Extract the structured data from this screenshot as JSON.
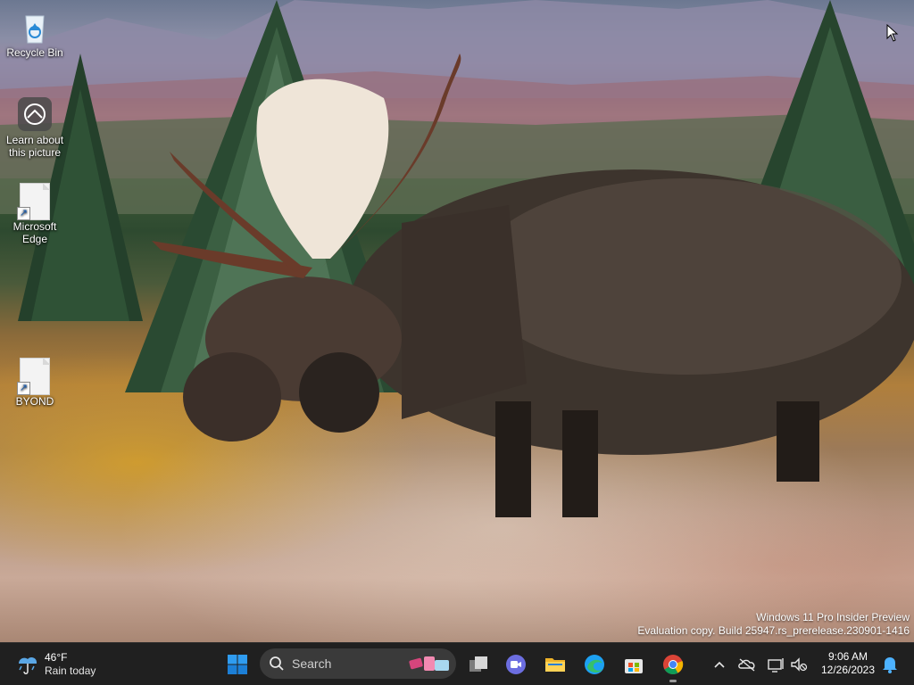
{
  "desktop": {
    "icons": [
      {
        "label": "Recycle Bin",
        "icon": "recycle-bin-icon"
      },
      {
        "label": "Learn about this picture",
        "icon": "learn-about-picture-icon"
      },
      {
        "label": "Microsoft Edge",
        "icon": "file-shortcut-icon"
      },
      {
        "label": "BYOND",
        "icon": "file-shortcut-icon"
      }
    ],
    "watermark": {
      "line1": "Windows 11 Pro Insider Preview",
      "line2": "Evaluation copy. Build 25947.rs_prerelease.230901-1416"
    }
  },
  "taskbar": {
    "weather": {
      "temp": "46°F",
      "text": "Rain today",
      "icon": "rain-cloud-icon"
    },
    "start_icon": "windows-start-icon",
    "search": {
      "placeholder": "Search",
      "icon": "search-icon"
    },
    "pinned": [
      {
        "name": "task-view",
        "icon": "task-view-icon"
      },
      {
        "name": "meet-now",
        "icon": "video-camera-icon"
      },
      {
        "name": "file-explorer",
        "icon": "folder-icon"
      },
      {
        "name": "microsoft-edge",
        "icon": "edge-icon"
      },
      {
        "name": "microsoft-store",
        "icon": "store-icon"
      },
      {
        "name": "google-chrome",
        "icon": "chrome-icon"
      }
    ],
    "tray": {
      "chevron_icon": "chevron-up-icon",
      "icons": [
        "cloud-offline-icon",
        "network-icon",
        "volume-muted-icon"
      ],
      "time": "9:06 AM",
      "date": "12/26/2023",
      "notification_icon": "bell-icon"
    },
    "colors": {
      "background": "#202020",
      "accent": "#0078d4"
    }
  }
}
